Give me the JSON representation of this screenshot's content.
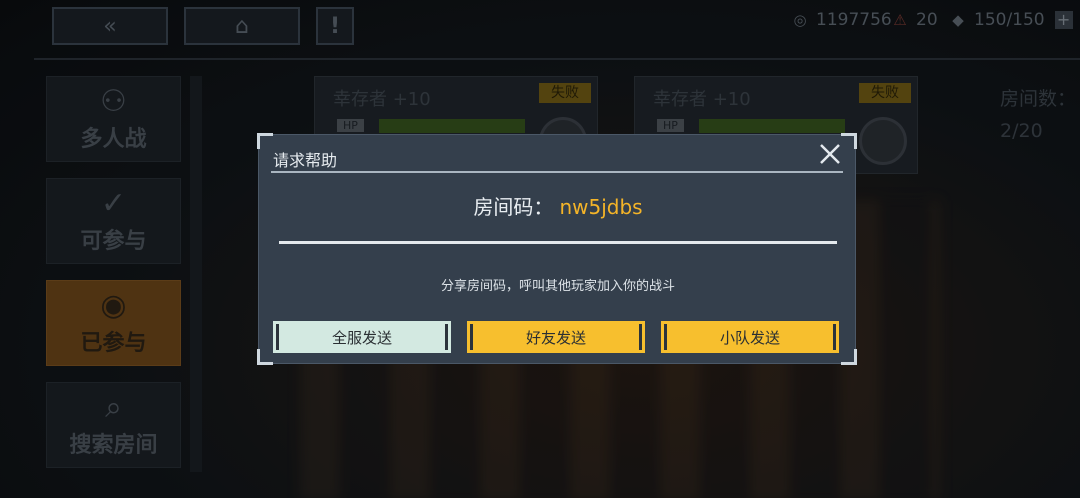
{
  "topbar": {
    "resources": {
      "coins": "1197756",
      "energy": "20",
      "tickets": "150/150"
    }
  },
  "sidebar": {
    "items": [
      {
        "label": "多人战"
      },
      {
        "label": "可参与"
      },
      {
        "label": "已参与"
      },
      {
        "label": "搜索房间"
      }
    ]
  },
  "cards": [
    {
      "name": "幸存者 +10",
      "status": "失败",
      "hp_label": "HP"
    },
    {
      "name": "幸存者 +10",
      "status": "失败",
      "hp_label": "HP"
    }
  ],
  "room_count": {
    "label": "房间数：",
    "value": "2/20"
  },
  "modal": {
    "title": "请求帮助",
    "room_code_label": "房间码：",
    "room_code": "nw5jdbs",
    "hint": "分享房间码，呼叫其他玩家加入你的战斗",
    "buttons": {
      "all_server": "全服发送",
      "friends": "好友发送",
      "team": "小队发送"
    }
  },
  "colors": {
    "accent_yellow": "#f7bf2e",
    "code_color": "#f4b428",
    "modal_bg": "#343f4c",
    "active_tab": "#6a4419"
  }
}
